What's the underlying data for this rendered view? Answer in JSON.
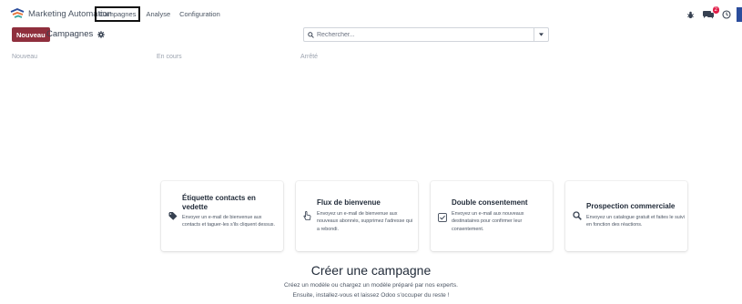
{
  "navbar": {
    "app_name": "Marketing Automation",
    "menu": [
      "Campagnes",
      "Analyse",
      "Configuration"
    ],
    "icons": [
      "app-logo-icon",
      "bug-icon",
      "chat-icon",
      "clock-icon"
    ],
    "chat_badge": "2"
  },
  "control": {
    "new_button": "Nouveau",
    "breadcrumb": "Campagnes",
    "search_placeholder": "Rechercher..."
  },
  "kanban": {
    "columns": [
      "Nouveau",
      "En cours",
      "Arrêté"
    ]
  },
  "helper": {
    "cards": [
      {
        "title": "Étiquette contacts en vedette",
        "desc": "Envoyer un e-mail de bienvenue aux contacts et taguer-les s'ils cliquent dessus.",
        "icon": "tag-icon"
      },
      {
        "title": "Flux de bienvenue",
        "desc": "Envoyez un e-mail de bienvenue aux nouveaux abonnés, supprimez l'adresse qui a rebondi.",
        "icon": "hand-pointer-icon"
      },
      {
        "title": "Double consentement",
        "desc": "Envoyez un e-mail aux nouveaux destinataires pour confirmer leur consentement.",
        "icon": "check-square-icon"
      },
      {
        "title": "Prospection commerciale",
        "desc": "Envoyez un catalogue gratuit et faites le suivi en fonction des réactions.",
        "icon": "search-icon"
      }
    ],
    "title": "Créer une campagne",
    "line1": "Créez un modèle ou chargez un modèle préparé par nos experts.",
    "line2": "Ensuite, installez-vous et laissez Odoo s'occuper du reste !"
  },
  "colors": {
    "primary": "#8f2f3d",
    "badge": "#e11d48",
    "avatar": "#2b4d9c"
  }
}
